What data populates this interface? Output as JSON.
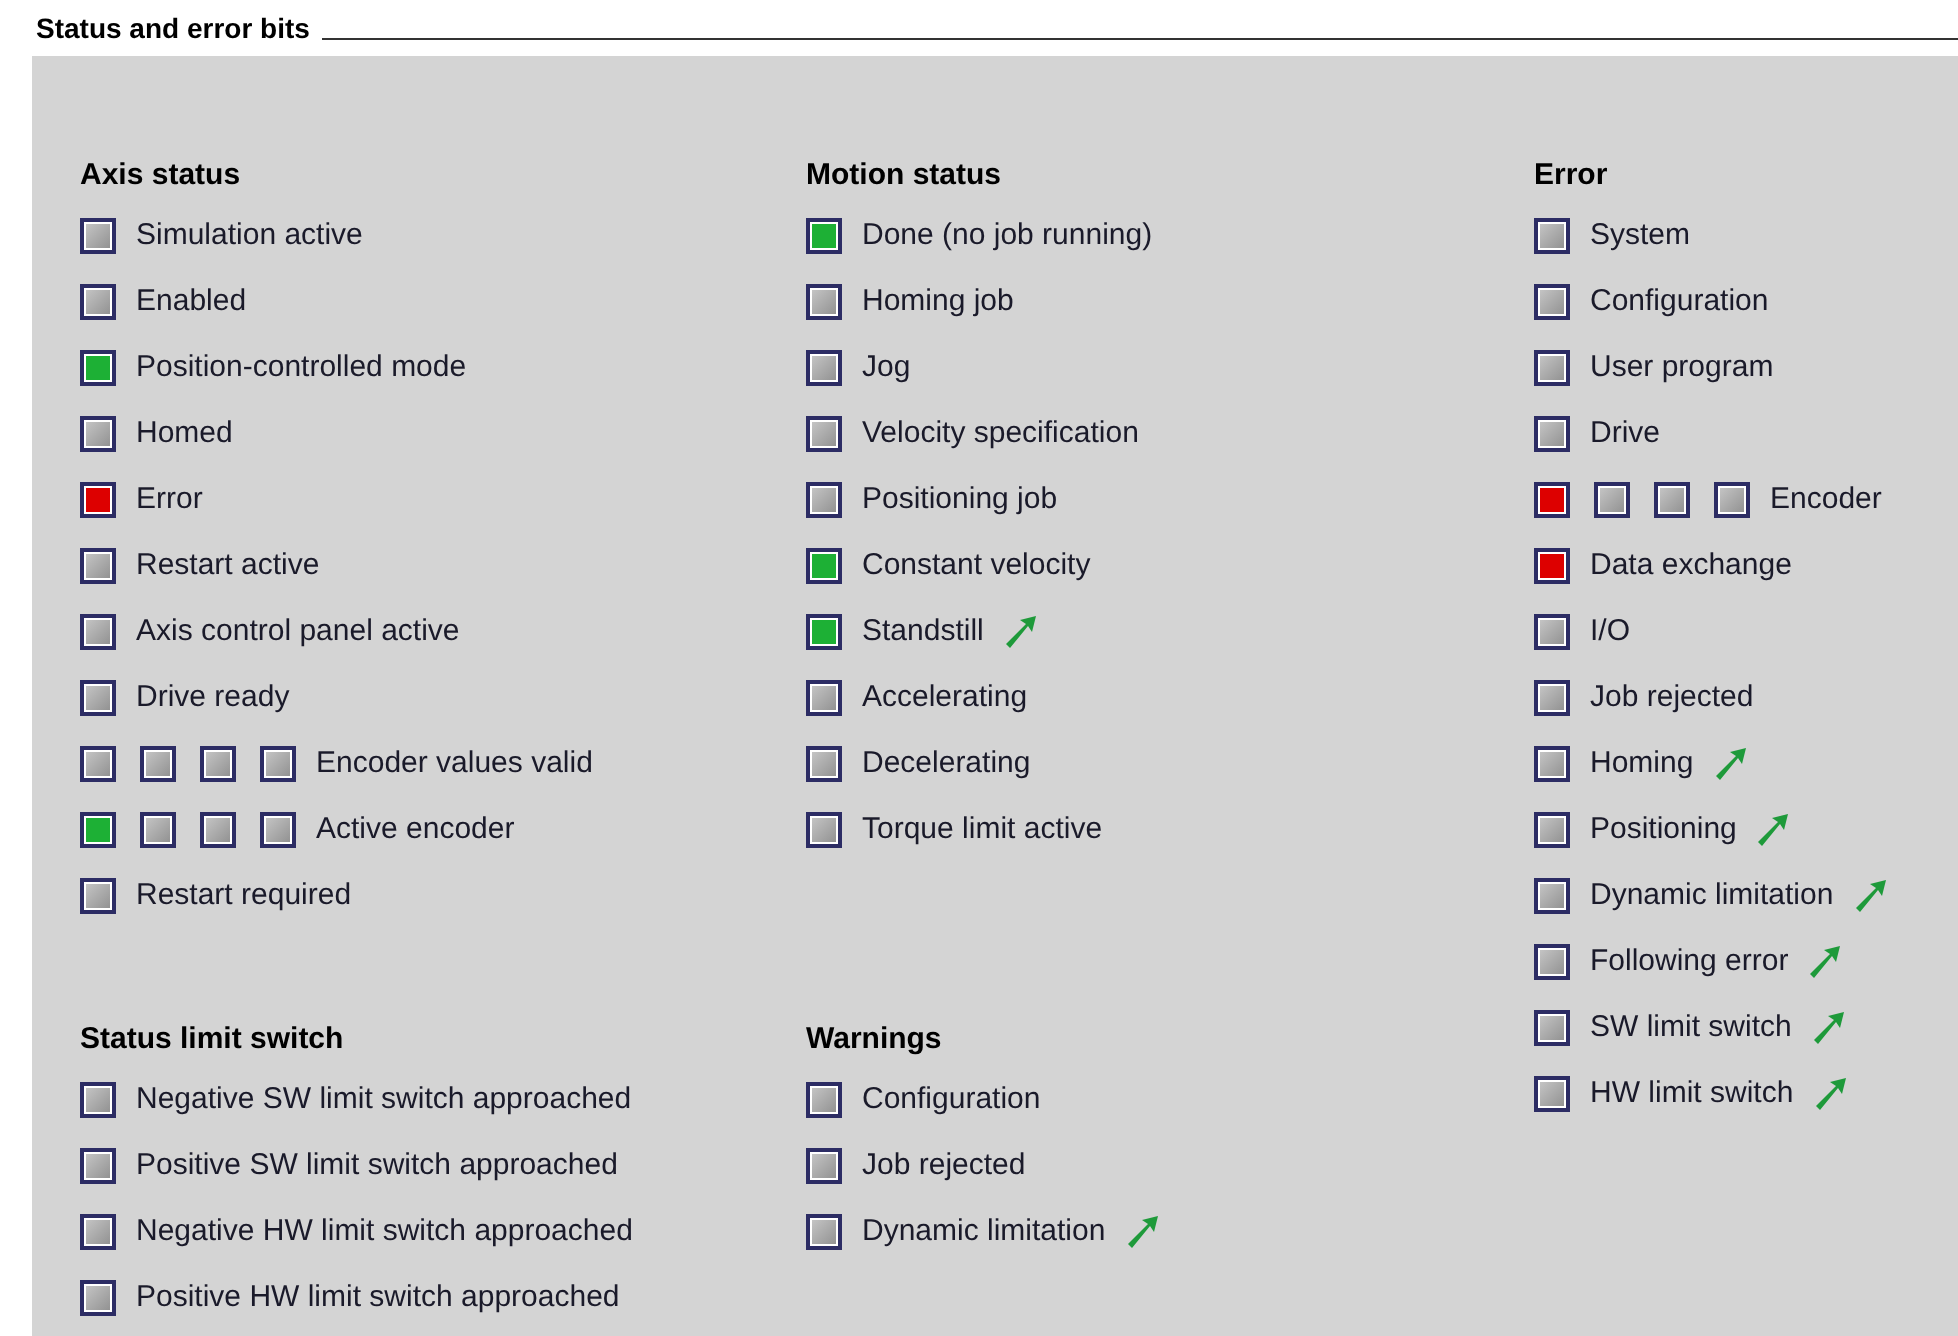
{
  "title": "Status and error bits",
  "columns": [
    {
      "groups": [
        {
          "heading": "Axis status",
          "items": [
            {
              "label": "Simulation active",
              "lamps": [
                {
                  "on": false
                }
              ],
              "link": false
            },
            {
              "label": "Enabled",
              "lamps": [
                {
                  "on": false
                }
              ],
              "link": false
            },
            {
              "label": "Position-controlled mode",
              "lamps": [
                {
                  "on": true,
                  "color": "#1db035"
                }
              ],
              "link": false
            },
            {
              "label": "Homed",
              "lamps": [
                {
                  "on": false
                }
              ],
              "link": false
            },
            {
              "label": "Error",
              "lamps": [
                {
                  "on": true,
                  "color": "#dd0000"
                }
              ],
              "link": false
            },
            {
              "label": "Restart active",
              "lamps": [
                {
                  "on": false
                }
              ],
              "link": false
            },
            {
              "label": "Axis control panel active",
              "lamps": [
                {
                  "on": false
                }
              ],
              "link": false
            },
            {
              "label": "Drive ready",
              "lamps": [
                {
                  "on": false
                }
              ],
              "link": false
            },
            {
              "label": "Encoder values valid",
              "lamps": [
                {
                  "on": false
                },
                {
                  "on": false
                },
                {
                  "on": false
                },
                {
                  "on": false
                }
              ],
              "link": false
            },
            {
              "label": "Active encoder",
              "lamps": [
                {
                  "on": true,
                  "color": "#1db035"
                },
                {
                  "on": false
                },
                {
                  "on": false
                },
                {
                  "on": false
                }
              ],
              "link": false
            },
            {
              "label": "Restart required",
              "lamps": [
                {
                  "on": false
                }
              ],
              "link": false
            }
          ]
        },
        {
          "heading": "Status limit switch",
          "items": [
            {
              "label": "Negative SW limit switch approached",
              "lamps": [
                {
                  "on": false
                }
              ],
              "link": false
            },
            {
              "label": "Positive SW limit switch approached",
              "lamps": [
                {
                  "on": false
                }
              ],
              "link": false
            },
            {
              "label": "Negative HW limit switch approached",
              "lamps": [
                {
                  "on": false
                }
              ],
              "link": false
            },
            {
              "label": "Positive HW limit switch approached",
              "lamps": [
                {
                  "on": false
                }
              ],
              "link": false
            }
          ]
        }
      ]
    },
    {
      "groups": [
        {
          "heading": "Motion status",
          "items": [
            {
              "label": "Done (no job running)",
              "lamps": [
                {
                  "on": true,
                  "color": "#1db035"
                }
              ],
              "link": false
            },
            {
              "label": "Homing job",
              "lamps": [
                {
                  "on": false
                }
              ],
              "link": false
            },
            {
              "label": "Jog",
              "lamps": [
                {
                  "on": false
                }
              ],
              "link": false
            },
            {
              "label": "Velocity specification",
              "lamps": [
                {
                  "on": false
                }
              ],
              "link": false
            },
            {
              "label": "Positioning job",
              "lamps": [
                {
                  "on": false
                }
              ],
              "link": false
            },
            {
              "label": "Constant velocity",
              "lamps": [
                {
                  "on": true,
                  "color": "#1db035"
                }
              ],
              "link": false
            },
            {
              "label": "Standstill",
              "lamps": [
                {
                  "on": true,
                  "color": "#1db035"
                }
              ],
              "link": true
            },
            {
              "label": "Accelerating",
              "lamps": [
                {
                  "on": false
                }
              ],
              "link": false
            },
            {
              "label": "Decelerating",
              "lamps": [
                {
                  "on": false
                }
              ],
              "link": false
            },
            {
              "label": "Torque limit active",
              "lamps": [
                {
                  "on": false
                }
              ],
              "link": false
            }
          ]
        },
        {
          "heading": "Warnings",
          "items": [
            {
              "label": "Configuration",
              "lamps": [
                {
                  "on": false
                }
              ],
              "link": false
            },
            {
              "label": "Job rejected",
              "lamps": [
                {
                  "on": false
                }
              ],
              "link": false
            },
            {
              "label": "Dynamic limitation",
              "lamps": [
                {
                  "on": false
                }
              ],
              "link": true
            }
          ]
        }
      ]
    },
    {
      "groups": [
        {
          "heading": "Error",
          "items": [
            {
              "label": "System",
              "lamps": [
                {
                  "on": false
                }
              ],
              "link": false
            },
            {
              "label": "Configuration",
              "lamps": [
                {
                  "on": false
                }
              ],
              "link": false
            },
            {
              "label": "User program",
              "lamps": [
                {
                  "on": false
                }
              ],
              "link": false
            },
            {
              "label": "Drive",
              "lamps": [
                {
                  "on": false
                }
              ],
              "link": false
            },
            {
              "label": "Encoder",
              "lamps": [
                {
                  "on": true,
                  "color": "#dd0000"
                },
                {
                  "on": false
                },
                {
                  "on": false
                },
                {
                  "on": false
                }
              ],
              "link": false
            },
            {
              "label": "Data exchange",
              "lamps": [
                {
                  "on": true,
                  "color": "#dd0000"
                }
              ],
              "link": false
            },
            {
              "label": "I/O",
              "lamps": [
                {
                  "on": false
                }
              ],
              "link": false
            },
            {
              "label": "Job rejected",
              "lamps": [
                {
                  "on": false
                }
              ],
              "link": false
            },
            {
              "label": "Homing",
              "lamps": [
                {
                  "on": false
                }
              ],
              "link": true
            },
            {
              "label": "Positioning",
              "lamps": [
                {
                  "on": false
                }
              ],
              "link": true
            },
            {
              "label": "Dynamic limitation",
              "lamps": [
                {
                  "on": false
                }
              ],
              "link": true
            },
            {
              "label": "Following error",
              "lamps": [
                {
                  "on": false
                }
              ],
              "link": true
            },
            {
              "label": "SW limit switch",
              "lamps": [
                {
                  "on": false
                }
              ],
              "link": true
            },
            {
              "label": "HW limit switch",
              "lamps": [
                {
                  "on": false
                }
              ],
              "link": true
            }
          ]
        }
      ]
    }
  ]
}
